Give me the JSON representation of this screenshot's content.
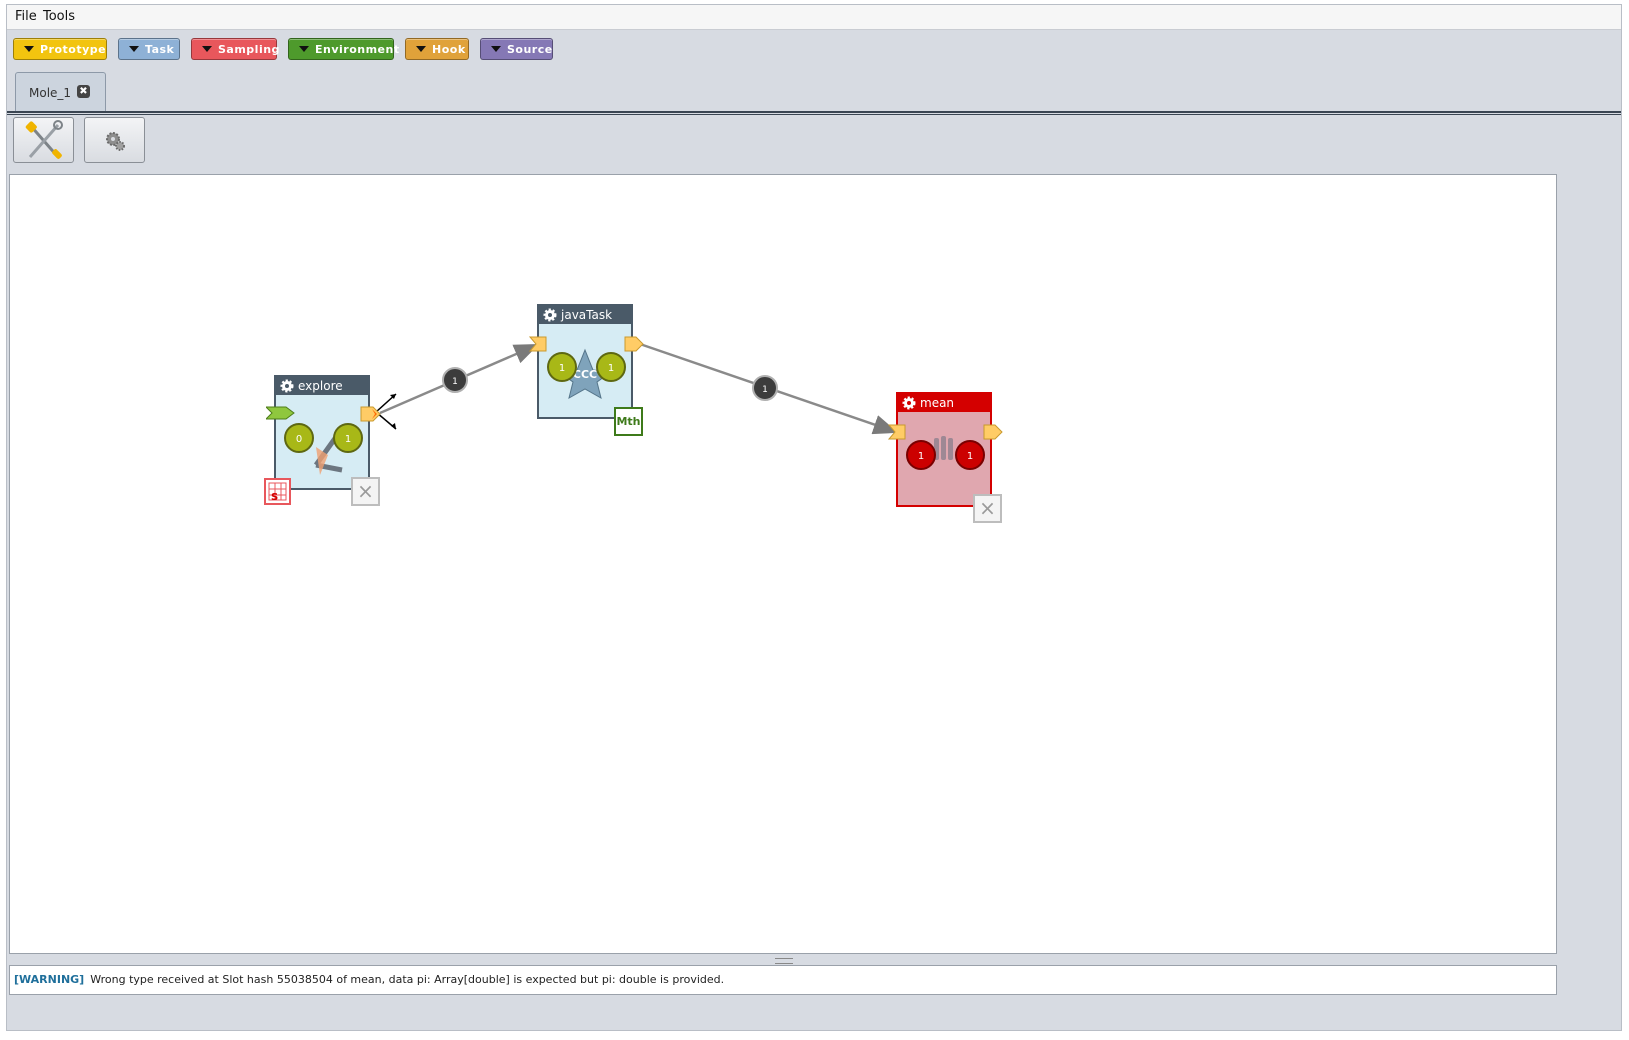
{
  "menu": {
    "items": [
      "File",
      "Tools"
    ]
  },
  "palette": {
    "buttons": [
      {
        "label": "Prototype",
        "color": "#f2c40f"
      },
      {
        "label": "Task",
        "color": "#8eb1d6"
      },
      {
        "label": "Sampling",
        "color": "#e8575c"
      },
      {
        "label": "Environment",
        "color": "#4e9a2c"
      },
      {
        "label": "Hook",
        "color": "#e0a23a"
      },
      {
        "label": "Source",
        "color": "#8578b5"
      }
    ]
  },
  "tabs": [
    {
      "label": "Mole_1",
      "close_icon": "close-icon"
    }
  ],
  "toolbar": {
    "buttons": [
      {
        "name": "build-mode",
        "icon": "wrench-screwdriver-icon"
      },
      {
        "name": "execution-mode",
        "icon": "gears-icon"
      }
    ]
  },
  "workflow": {
    "capsules": [
      {
        "title": "explore",
        "input_slot": "0",
        "output_slot": "1",
        "theme": "blue",
        "badge": "sampling-icon"
      },
      {
        "title": "javaTask",
        "input_slot": "1",
        "output_slot": "1",
        "theme": "blue",
        "badge_text": "Mth"
      },
      {
        "title": "mean",
        "input_slot": "1",
        "output_slot": "1",
        "theme": "red",
        "badge": "none"
      }
    ],
    "transitions": [
      {
        "from": "explore",
        "to": "javaTask",
        "label": "1"
      },
      {
        "from": "javaTask",
        "to": "mean",
        "label": "1"
      }
    ],
    "colors": {
      "header": "#4a5a68",
      "capsule_bg": "#d6ecf4",
      "error_red": "#d40000",
      "error_bg": "#e0a7af",
      "slot_green": "#a8b817"
    }
  },
  "console": {
    "level": "[WARNING]",
    "message": "Wrong type received at Slot hash 55038504 of mean, data pi: Array[double] is expected but pi: double is provided."
  }
}
